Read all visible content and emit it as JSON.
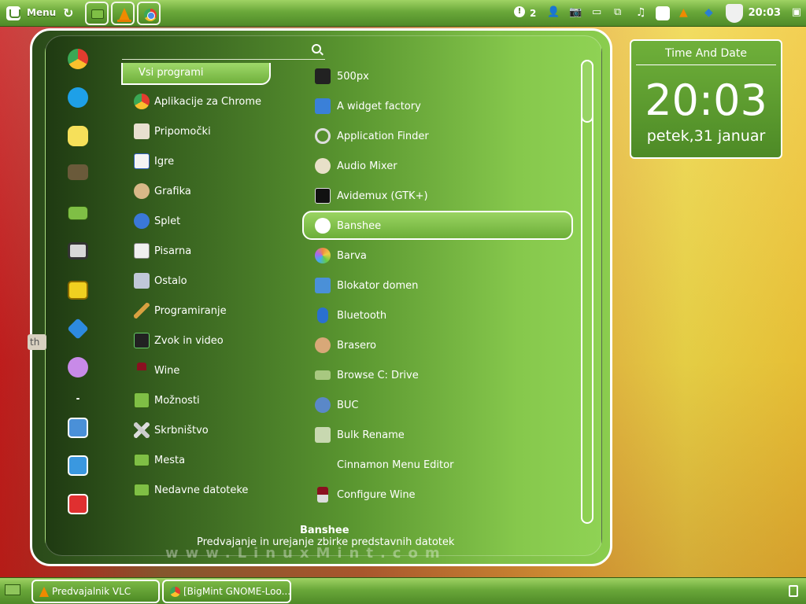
{
  "top_panel": {
    "menu_label": "Menu",
    "notification_count": "2",
    "clock": "20:03"
  },
  "menu": {
    "search": {
      "value": "",
      "placeholder": ""
    },
    "categories": [
      {
        "label": "Vsi programi",
        "selected": true
      },
      {
        "label": "Aplikacije za Chrome"
      },
      {
        "label": "Pripomočki"
      },
      {
        "label": "Igre"
      },
      {
        "label": "Grafika"
      },
      {
        "label": "Splet"
      },
      {
        "label": "Pisarna"
      },
      {
        "label": "Ostalo"
      },
      {
        "label": "Programiranje"
      },
      {
        "label": "Zvok in video"
      },
      {
        "label": "Wine"
      },
      {
        "label": "Možnosti"
      },
      {
        "label": "Skrbništvo"
      },
      {
        "label": "Mesta"
      },
      {
        "label": "Nedavne datoteke"
      }
    ],
    "applications": [
      {
        "label": "500px"
      },
      {
        "label": "A widget factory"
      },
      {
        "label": "Application Finder"
      },
      {
        "label": "Audio Mixer"
      },
      {
        "label": "Avidemux (GTK+)"
      },
      {
        "label": "Banshee",
        "selected": true
      },
      {
        "label": "Barva"
      },
      {
        "label": "Blokator domen"
      },
      {
        "label": "Bluetooth"
      },
      {
        "label": "Brasero"
      },
      {
        "label": "Browse C: Drive"
      },
      {
        "label": "BUC"
      },
      {
        "label": "Bulk Rename"
      },
      {
        "label": "Cinnamon Menu Editor"
      },
      {
        "label": "Configure Wine"
      }
    ],
    "selected_app": {
      "name": "Banshee",
      "description": "Predvajanje in urejanje zbirke predstavnih datotek"
    },
    "watermark": "www.LinuxMint.com"
  },
  "desklet": {
    "title": "Time And Date",
    "time": "20:03",
    "date": "petek,31 januar"
  },
  "side_tip": "th",
  "taskbar": {
    "tasks": [
      {
        "label": "Predvajalnik VLC"
      },
      {
        "label": "[BigMint GNOME-Loo..."
      }
    ]
  },
  "colors": {
    "accent": "#6aa83a",
    "accent_light": "#9fd263",
    "highlight": "#ffffff"
  }
}
